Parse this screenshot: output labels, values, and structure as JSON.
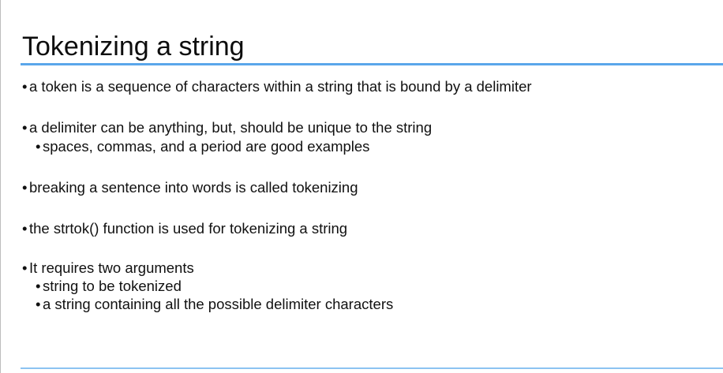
{
  "slide": {
    "title": "Tokenizing a string",
    "bullet_symbol": "•",
    "bullets": [
      {
        "text": "a token is a sequence of characters within a string that is bound by a delimiter"
      },
      {
        "text": "a delimiter can be anything, but, should be unique to the string"
      },
      {
        "text": "spaces, commas, and a period are good examples"
      },
      {
        "text": "breaking a sentence into words is called tokenizing"
      },
      {
        "text": "the strtok() function is used for tokenizing a string"
      },
      {
        "text": "It requires two arguments"
      },
      {
        "text": "string to be tokenized"
      },
      {
        "text": "a string containing all the possible delimiter characters"
      }
    ],
    "accent_color": "#5aa6ea"
  }
}
